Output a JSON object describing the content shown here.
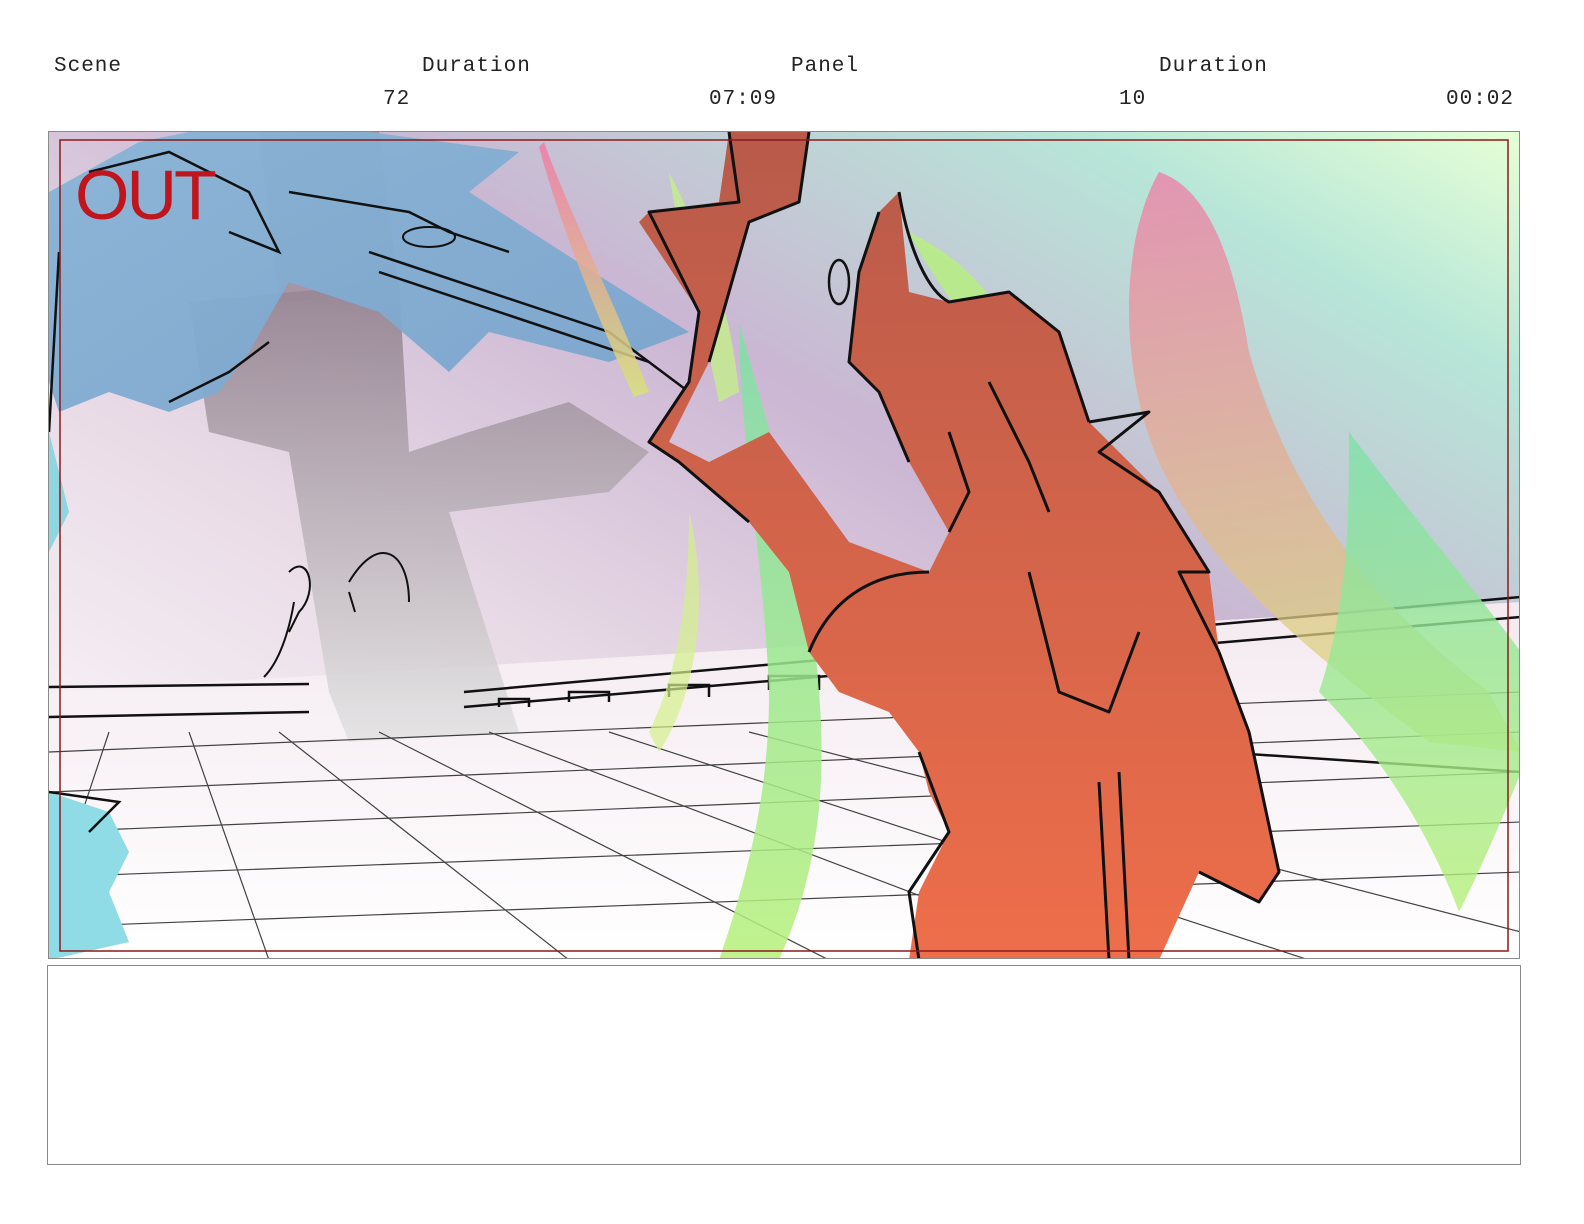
{
  "header": {
    "scene_label": "Scene",
    "scene_duration_label": "Duration",
    "panel_label": "Panel",
    "panel_duration_label": "Duration",
    "scene_number": "72",
    "scene_duration": "07:09",
    "panel_number": "10",
    "panel_duration": "00:02"
  },
  "panel": {
    "overlay_text": "OUT",
    "overlay_color": "#c0151c",
    "safe_frame_color": "#8b1a1a"
  },
  "notes": {
    "text": ""
  }
}
